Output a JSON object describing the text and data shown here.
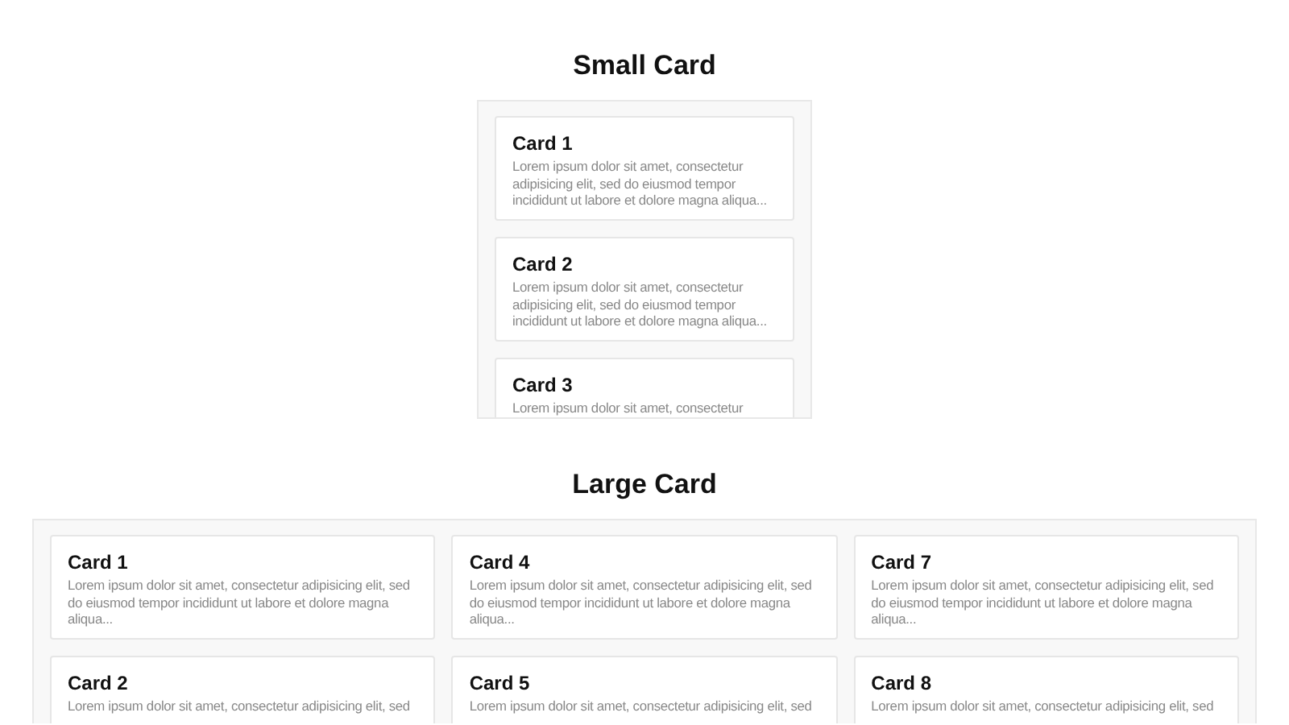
{
  "sections": [
    {
      "kind": "small",
      "title": "Small Card",
      "cards": [
        {
          "title": "Card 1",
          "text": "Lorem ipsum dolor sit amet, consectetur adipisicing elit, sed do eiusmod tempor incididunt ut labore et dolore magna aliqua..."
        },
        {
          "title": "Card 2",
          "text": "Lorem ipsum dolor sit amet, consectetur adipisicing elit, sed do eiusmod tempor incididunt ut labore et dolore magna aliqua..."
        },
        {
          "title": "Card 3",
          "text": "Lorem ipsum dolor sit amet, consectetur"
        }
      ]
    },
    {
      "kind": "large",
      "title": "Large Card",
      "cards": [
        {
          "title": "Card 1",
          "text": "Lorem ipsum dolor sit amet, consectetur adipisicing elit, sed do eiusmod tempor incididunt ut labore et dolore magna aliqua..."
        },
        {
          "title": "Card 2",
          "text": "Lorem ipsum dolor sit amet, consectetur adipisicing elit, sed"
        },
        {
          "title": "Card 4",
          "text": "Lorem ipsum dolor sit amet, consectetur adipisicing elit, sed do eiusmod tempor incididunt ut labore et dolore magna aliqua..."
        },
        {
          "title": "Card 5",
          "text": "Lorem ipsum dolor sit amet, consectetur adipisicing elit, sed"
        },
        {
          "title": "Card 7",
          "text": "Lorem ipsum dolor sit amet, consectetur adipisicing elit, sed do eiusmod tempor incididunt ut labore et dolore magna aliqua..."
        },
        {
          "title": "Card 8",
          "text": "Lorem ipsum dolor sit amet, consectetur adipisicing elit, sed"
        }
      ]
    }
  ]
}
